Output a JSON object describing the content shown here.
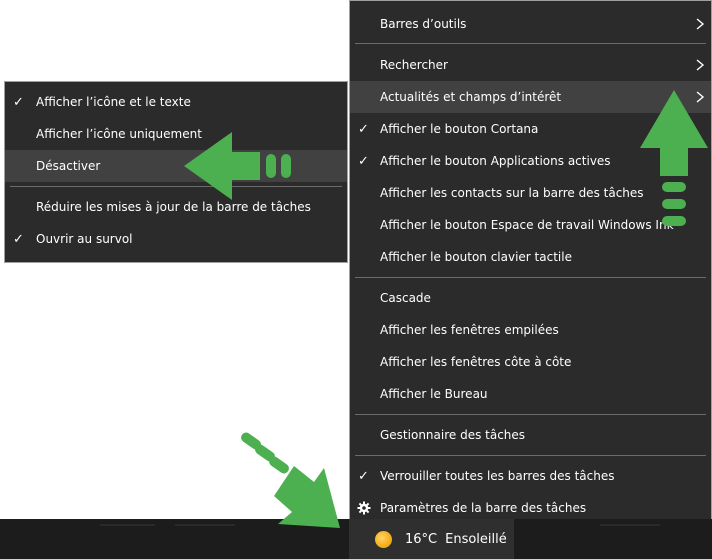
{
  "main_menu": {
    "items": [
      {
        "label": "Barres d’outils",
        "checked": false,
        "submenu": true
      },
      {
        "label": "Rechercher",
        "checked": false,
        "submenu": true
      },
      {
        "label": "Actualités et champs d’intérêt",
        "checked": false,
        "submenu": true,
        "highlighted": true
      },
      {
        "label": "Afficher le bouton Cortana",
        "checked": true
      },
      {
        "label": "Afficher le bouton Applications actives",
        "checked": true
      },
      {
        "label": "Afficher les contacts sur la barre des tâches",
        "checked": false
      },
      {
        "label": "Afficher le bouton Espace de travail Windows Ink",
        "checked": false
      },
      {
        "label": "Afficher le bouton clavier tactile",
        "checked": false
      },
      {
        "label": "Cascade"
      },
      {
        "label": "Afficher les fenêtres empilées"
      },
      {
        "label": "Afficher les fenêtres côte à côte"
      },
      {
        "label": "Afficher le Bureau"
      },
      {
        "label": "Gestionnaire des tâches"
      },
      {
        "label": "Verrouiller toutes les barres des tâches",
        "checked": true
      },
      {
        "label": "Paramètres de la barre des tâches",
        "icon": "gear-icon"
      }
    ]
  },
  "sub_menu": {
    "items": [
      {
        "label": "Afficher l’icône et le texte",
        "checked": true
      },
      {
        "label": "Afficher l’icône uniquement",
        "checked": false
      },
      {
        "label": "Désactiver",
        "highlighted": true
      },
      {
        "label": "Réduire les mises à jour de la barre de tâches",
        "checked": false
      },
      {
        "label": "Ouvrir au survol",
        "checked": true
      }
    ]
  },
  "taskbar": {
    "weather": {
      "icon": "sun-icon",
      "temperature": "16°C",
      "condition": "Ensoleillé"
    }
  },
  "colors": {
    "menu_bg": "#2b2b2b",
    "highlight": "#414141",
    "separator": "#6b6b6b",
    "taskbar_bg": "#1c1c1c",
    "arrow_green": "#4caf50"
  },
  "icons": {
    "check": "checkmark-icon",
    "submenu": "chevron-right-icon"
  }
}
